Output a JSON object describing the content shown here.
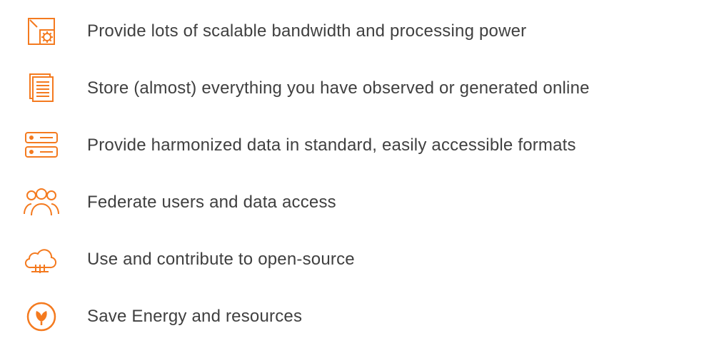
{
  "accent": "#F47A1F",
  "items": [
    {
      "icon": "scale-gear-icon",
      "label": "Provide lots of scalable bandwidth and processing power"
    },
    {
      "icon": "documents-icon",
      "label": "Store (almost) everything you have observed or generated online"
    },
    {
      "icon": "servers-icon",
      "label": "Provide harmonized data in standard, easily accessible formats"
    },
    {
      "icon": "users-group-icon",
      "label": "Federate users and data access"
    },
    {
      "icon": "cloud-icon",
      "label": "Use and contribute to open-source"
    },
    {
      "icon": "eco-leaf-icon",
      "label": "Save Energy and resources"
    }
  ]
}
